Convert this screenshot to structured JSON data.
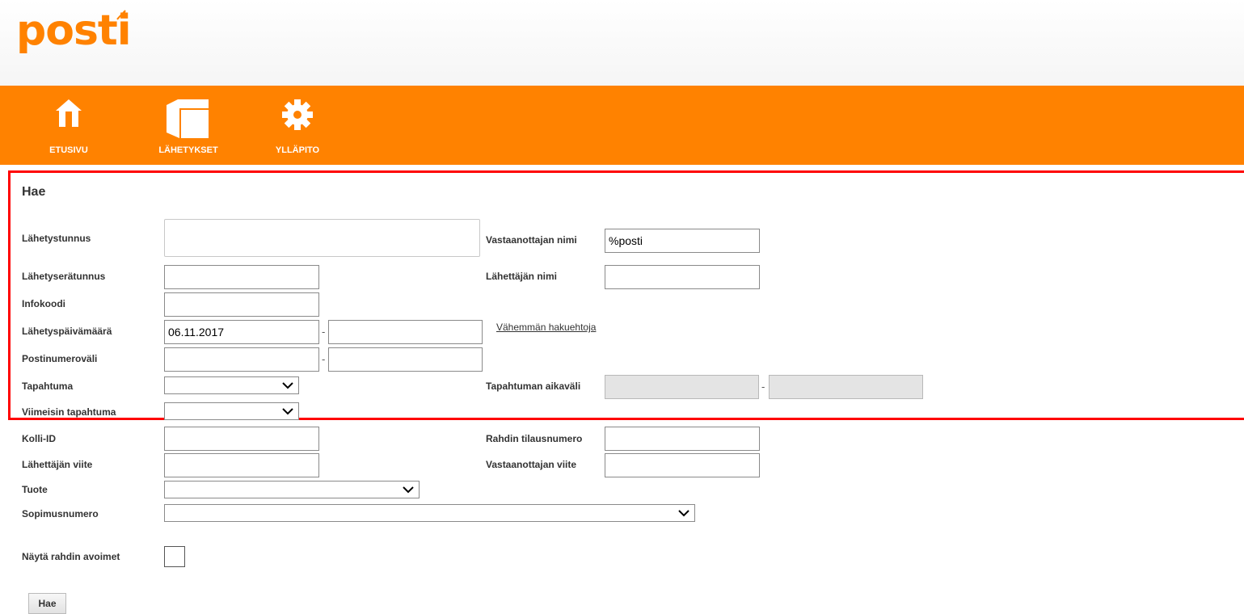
{
  "brand": {
    "logo_text": "posti",
    "accent_color": "#ff8200",
    "highlight_color": "#ff0000"
  },
  "nav": {
    "items": [
      {
        "label": "ETUSIVU",
        "icon": "home-icon"
      },
      {
        "label": "LÄHETYKSET",
        "icon": "package-icon"
      },
      {
        "label": "YLLÄPITO",
        "icon": "gear-icon"
      }
    ]
  },
  "form": {
    "title": "Hae",
    "labels": {
      "shipment_id": "Lähetystunnus",
      "batch_id": "Lähetyserätunnus",
      "info_code": "Infokoodi",
      "ship_date": "Lähetyspäivämäärä",
      "postal_range": "Postinumeroväli",
      "event": "Tapahtuma",
      "last_event": "Viimeisin tapahtuma",
      "parcel_id": "Kolli-ID",
      "sender_ref": "Lähettäjän viite",
      "product": "Tuote",
      "contract": "Sopimusnumero",
      "show_open": "Näytä rahdin avoimet",
      "recipient_name": "Vastaanottajan nimi",
      "sender_name": "Lähettäjän nimi",
      "event_range": "Tapahtuman aikaväli",
      "freight_order": "Rahdin tilausnumero",
      "recipient_ref": "Vastaanottajan viite"
    },
    "values": {
      "recipient_name": "%posti",
      "ship_date_from": "06.11.2017"
    },
    "range_separator": "-",
    "less_criteria_link": "Vähemmän hakuehtoja",
    "search_button": "Hae"
  }
}
